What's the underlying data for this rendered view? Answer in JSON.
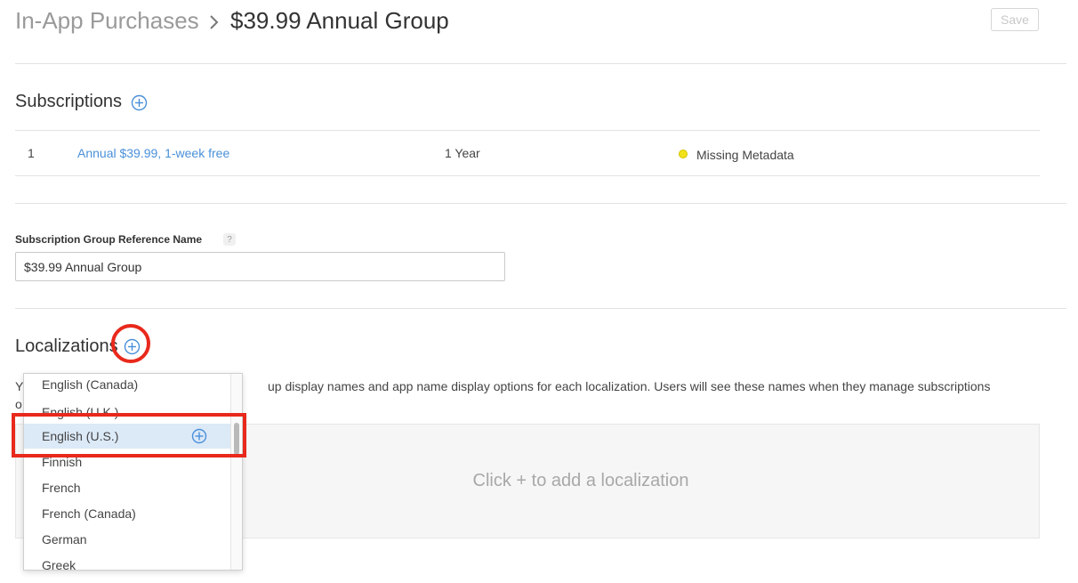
{
  "header": {
    "breadcrumb_parent": "In-App Purchases",
    "breadcrumb_current": "$39.99 Annual Group",
    "save_label": "Save"
  },
  "subscriptions": {
    "title": "Subscriptions",
    "rows": [
      {
        "rank": "1",
        "name": "Annual $39.99, 1-week free",
        "duration": "1 Year",
        "status": "Missing Metadata",
        "status_color": "#f2e21a"
      }
    ]
  },
  "reference_name": {
    "label": "Subscription Group Reference Name",
    "help": "?",
    "value": "$39.99 Annual Group"
  },
  "localizations": {
    "title": "Localizations",
    "description_visible_start": "Y",
    "description_visible_line2_start": "o",
    "description_visible_end": "up display names and app name display options for each localization. Users will see these names when they manage subscriptions",
    "empty_prompt": "Click + to add a localization",
    "dropdown_items": [
      {
        "label": "English (Canada)"
      },
      {
        "label": "English (U.K.)"
      },
      {
        "label": "English (U.S.)",
        "selected": true
      },
      {
        "label": "Finnish"
      },
      {
        "label": "French"
      },
      {
        "label": "French (Canada)"
      },
      {
        "label": "German"
      },
      {
        "label": "Greek"
      }
    ]
  },
  "colors": {
    "link": "#4a90d9",
    "annotation": "#e8291c",
    "selected_row": "#dce9f7"
  }
}
